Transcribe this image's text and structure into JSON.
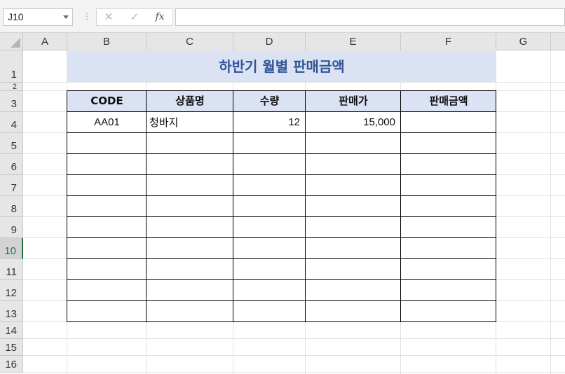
{
  "formula_bar": {
    "name_box": "J10",
    "cancel_icon": "✕",
    "enter_icon": "✓",
    "fx_label": "fx",
    "formula": ""
  },
  "columns": [
    "A",
    "B",
    "C",
    "D",
    "E",
    "F",
    "G"
  ],
  "rows": [
    "1",
    "2",
    "3",
    "4",
    "5",
    "6",
    "7",
    "8",
    "9",
    "10",
    "11",
    "12",
    "13",
    "14",
    "15",
    "16"
  ],
  "active_row": "10",
  "sheet": {
    "title": "하반기 월별 판매금액",
    "headers": [
      "CODE",
      "상품명",
      "수량",
      "판매가",
      "판매금액"
    ],
    "row4": {
      "code": "AA01",
      "name": "청바지",
      "qty": "12",
      "price": "15,000",
      "amount": ""
    }
  },
  "colors": {
    "header_fill": "#dbe2f3",
    "title_text": "#2f5597",
    "active_header": "#217346"
  }
}
